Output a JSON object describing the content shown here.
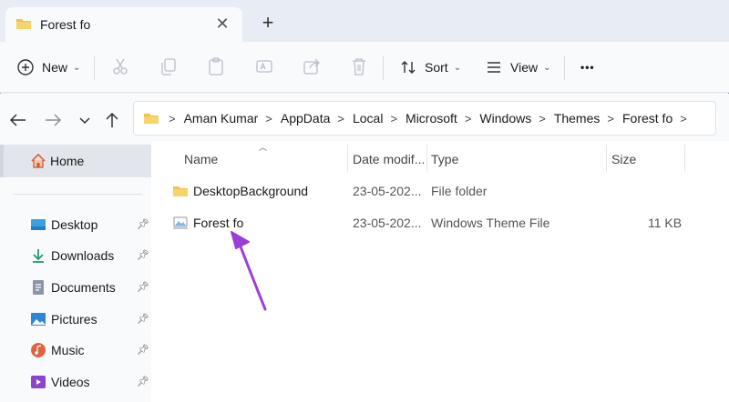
{
  "tab": {
    "title": "Forest fo",
    "close": "✕",
    "new_tab": "+"
  },
  "command_bar": {
    "new_label": "New",
    "sort_label": "Sort",
    "view_label": "View",
    "more_label": "•••"
  },
  "address": {
    "crumbs": [
      "Aman Kumar",
      "AppData",
      "Local",
      "Microsoft",
      "Windows",
      "Themes",
      "Forest fo"
    ]
  },
  "sidebar": {
    "home": "Home",
    "items": [
      {
        "label": "Desktop",
        "icon": "desktop-icon"
      },
      {
        "label": "Downloads",
        "icon": "download-icon"
      },
      {
        "label": "Documents",
        "icon": "documents-icon"
      },
      {
        "label": "Pictures",
        "icon": "pictures-icon"
      },
      {
        "label": "Music",
        "icon": "music-icon"
      },
      {
        "label": "Videos",
        "icon": "videos-icon"
      }
    ]
  },
  "columns": {
    "name": "Name",
    "date": "Date modif...",
    "type": "Type",
    "size": "Size"
  },
  "files": [
    {
      "name": "DesktopBackground",
      "date": "23-05-202...",
      "type": "File folder",
      "size": ""
    },
    {
      "name": "Forest fo",
      "date": "23-05-202...",
      "type": "Windows Theme File",
      "size": "11 KB"
    }
  ],
  "colors": {
    "accent_arrow": "#9b3fd6",
    "folder": "#f2c14e"
  }
}
